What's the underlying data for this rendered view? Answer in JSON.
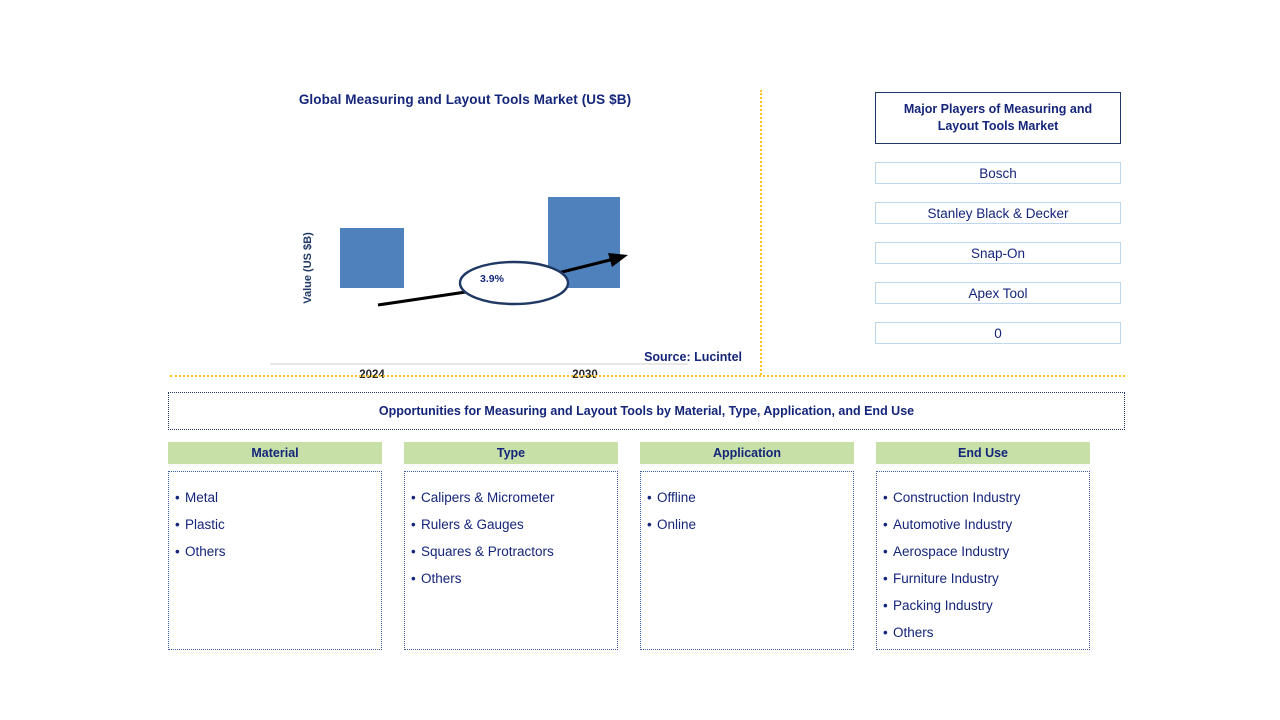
{
  "chart_data": {
    "type": "bar",
    "title": "Global Measuring and Layout Tools Market (US $B)",
    "xlabel": "",
    "ylabel": "Value (US $B)",
    "categories": [
      "2024",
      "2030"
    ],
    "values": [
      60,
      91
    ],
    "grid": false,
    "legend": null,
    "annotations": [
      {
        "label": "3.9%",
        "type": "cagr-callout",
        "from": "2024",
        "to": "2030"
      }
    ],
    "bar_color": "#4F81BD",
    "axis_color": "#E8E8E8"
  },
  "chart": {
    "title": "Global Measuring and Layout Tools Market (US $B)",
    "y_axis_label": "Value (US $B)",
    "cagr_label": "3.9%",
    "ticks": [
      "2024",
      "2030"
    ],
    "source": "Source: Lucintel"
  },
  "players": {
    "header": "Major Players of Measuring and Layout Tools Market",
    "items": [
      {
        "label": "Bosch"
      },
      {
        "label": "Stanley Black & Decker"
      },
      {
        "label": "Snap-On"
      },
      {
        "label": "Apex Tool"
      },
      {
        "label": "0"
      }
    ]
  },
  "opportunities": {
    "header": "Opportunities for Measuring and Layout Tools by Material, Type, Application, and End Use",
    "columns": [
      {
        "header": "Material",
        "items": [
          "Metal",
          "Plastic",
          "Others"
        ]
      },
      {
        "header": "Type",
        "items": [
          "Calipers & Micrometer",
          "Rulers & Gauges",
          "Squares & Protractors",
          "Others"
        ]
      },
      {
        "header": "Application",
        "items": [
          "Offline",
          "Online"
        ]
      },
      {
        "header": "End Use",
        "items": [
          "Construction Industry",
          "Automotive Industry",
          "Aerospace Industry",
          "Furniture Industry",
          "Packing Industry",
          "Others"
        ]
      }
    ]
  },
  "colors": {
    "navy": "#14257A",
    "bar_blue": "#4F81BD",
    "divider_gold": "#FFC222",
    "header_green": "#C6E0A8",
    "row_border_blue": "#BDD7EE"
  },
  "bullet_symbol": "•"
}
